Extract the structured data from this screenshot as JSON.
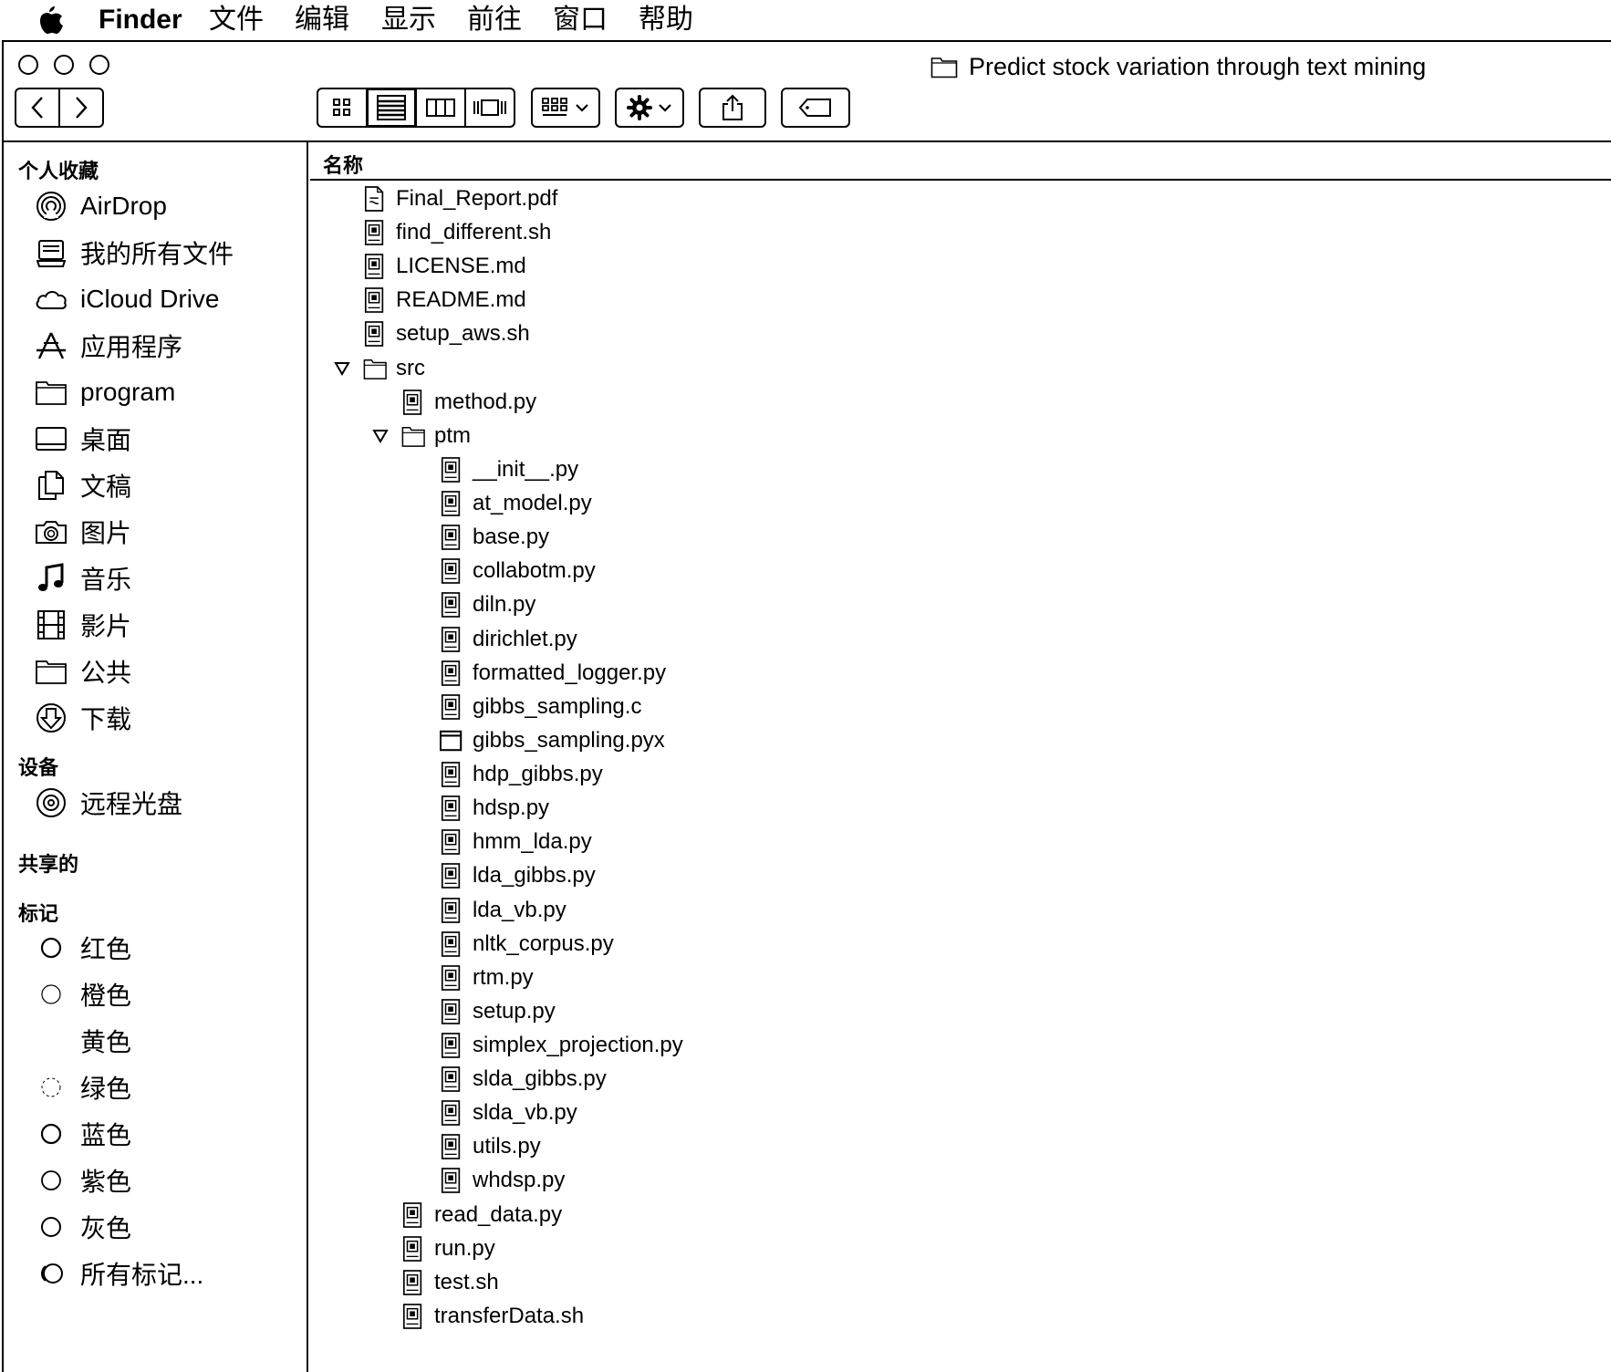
{
  "menubar": {
    "app_name": "Finder",
    "items": [
      "文件",
      "编辑",
      "显示",
      "前往",
      "窗口",
      "帮助"
    ]
  },
  "window": {
    "title": "Predict stock variation through text mining",
    "toolbar": {
      "view_modes": [
        "icon-view",
        "list-view",
        "column-view",
        "cover-flow-view"
      ],
      "active_view": "list-view"
    }
  },
  "sidebar": {
    "favorites_header": "个人收藏",
    "favorites": [
      {
        "label": "AirDrop",
        "icon": "airdrop-icon"
      },
      {
        "label": "我的所有文件",
        "icon": "all-files-icon"
      },
      {
        "label": "iCloud Drive",
        "icon": "cloud-icon"
      },
      {
        "label": "应用程序",
        "icon": "applications-icon"
      },
      {
        "label": "program",
        "icon": "folder-icon"
      },
      {
        "label": "桌面",
        "icon": "desktop-icon"
      },
      {
        "label": "文稿",
        "icon": "documents-icon"
      },
      {
        "label": "图片",
        "icon": "camera-icon"
      },
      {
        "label": "音乐",
        "icon": "music-icon"
      },
      {
        "label": "影片",
        "icon": "film-icon"
      },
      {
        "label": "公共",
        "icon": "folder-icon"
      },
      {
        "label": "下载",
        "icon": "download-icon"
      }
    ],
    "devices_header": "设备",
    "devices": [
      {
        "label": "远程光盘",
        "icon": "disc-icon"
      }
    ],
    "shared_header": "共享的",
    "tags_header": "标记",
    "tags": [
      {
        "label": "红色"
      },
      {
        "label": "橙色"
      },
      {
        "label": "黄色"
      },
      {
        "label": "绿色"
      },
      {
        "label": "蓝色"
      },
      {
        "label": "紫色"
      },
      {
        "label": "灰色"
      },
      {
        "label": "所有标记..."
      }
    ]
  },
  "file_list": {
    "column_name": "名称",
    "rows": [
      {
        "name": "Final_Report.pdf",
        "kind": "pdf",
        "depth": 0
      },
      {
        "name": "find_different.sh",
        "kind": "doc",
        "depth": 0
      },
      {
        "name": "LICENSE.md",
        "kind": "doc",
        "depth": 0
      },
      {
        "name": "README.md",
        "kind": "doc",
        "depth": 0
      },
      {
        "name": "setup_aws.sh",
        "kind": "doc",
        "depth": 0
      },
      {
        "name": "src",
        "kind": "folder",
        "depth": 0,
        "expanded": true
      },
      {
        "name": "method.py",
        "kind": "doc",
        "depth": 1
      },
      {
        "name": "ptm",
        "kind": "folder",
        "depth": 1,
        "expanded": true
      },
      {
        "name": "__init__.py",
        "kind": "doc",
        "depth": 2
      },
      {
        "name": "at_model.py",
        "kind": "doc",
        "depth": 2
      },
      {
        "name": "base.py",
        "kind": "doc",
        "depth": 2
      },
      {
        "name": "collabotm.py",
        "kind": "doc",
        "depth": 2
      },
      {
        "name": "diln.py",
        "kind": "doc",
        "depth": 2
      },
      {
        "name": "dirichlet.py",
        "kind": "doc",
        "depth": 2
      },
      {
        "name": "formatted_logger.py",
        "kind": "doc",
        "depth": 2
      },
      {
        "name": "gibbs_sampling.c",
        "kind": "doc",
        "depth": 2
      },
      {
        "name": "gibbs_sampling.pyx",
        "kind": "window",
        "depth": 2
      },
      {
        "name": "hdp_gibbs.py",
        "kind": "doc",
        "depth": 2
      },
      {
        "name": "hdsp.py",
        "kind": "doc",
        "depth": 2
      },
      {
        "name": "hmm_lda.py",
        "kind": "doc",
        "depth": 2
      },
      {
        "name": "lda_gibbs.py",
        "kind": "doc",
        "depth": 2
      },
      {
        "name": "lda_vb.py",
        "kind": "doc",
        "depth": 2
      },
      {
        "name": "nltk_corpus.py",
        "kind": "doc",
        "depth": 2
      },
      {
        "name": "rtm.py",
        "kind": "doc",
        "depth": 2
      },
      {
        "name": "setup.py",
        "kind": "doc",
        "depth": 2
      },
      {
        "name": "simplex_projection.py",
        "kind": "doc",
        "depth": 2
      },
      {
        "name": "slda_gibbs.py",
        "kind": "doc",
        "depth": 2
      },
      {
        "name": "slda_vb.py",
        "kind": "doc",
        "depth": 2
      },
      {
        "name": "utils.py",
        "kind": "doc",
        "depth": 2
      },
      {
        "name": "whdsp.py",
        "kind": "doc",
        "depth": 2
      },
      {
        "name": "read_data.py",
        "kind": "doc",
        "depth": 1
      },
      {
        "name": "run.py",
        "kind": "doc",
        "depth": 1
      },
      {
        "name": "test.sh",
        "kind": "doc",
        "depth": 1
      },
      {
        "name": "transferData.sh",
        "kind": "doc",
        "depth": 1
      }
    ]
  }
}
